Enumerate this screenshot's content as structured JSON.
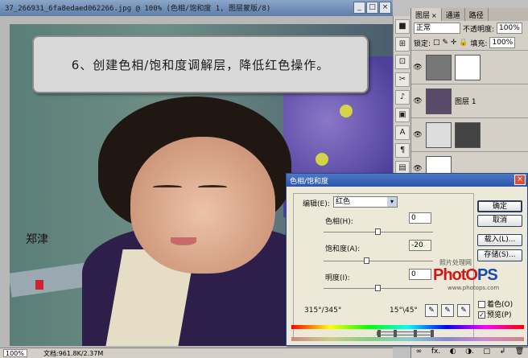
{
  "document": {
    "title": "37_266931_6fa8edaed062266.jpg @ 100% (色相/饱和度 1, 图层蒙版/8)",
    "window_buttons": [
      "_",
      "□",
      "×"
    ],
    "banner_text": "6、创建色相/饱和度调解层，降低红色操作。",
    "status_zoom": "100%",
    "status_doc": "文档:961.8K/2.37M",
    "signature": "郑津"
  },
  "tools": [
    "■",
    "⊞",
    "⊡",
    "✂",
    "♪",
    "▣",
    "A",
    "¶",
    "▤"
  ],
  "layers_panel": {
    "tabs": [
      {
        "label": "图层",
        "close": "×"
      },
      {
        "label": "通道",
        "close": ""
      },
      {
        "label": "路径",
        "close": ""
      }
    ],
    "blend_mode": "正常",
    "opacity_label": "不透明度:",
    "opacity_value": "100%",
    "lock_label": "锁定:",
    "fill_label": "填充:",
    "fill_value": "100%",
    "layers": [
      {
        "name": ""
      },
      {
        "name": "图层 1"
      },
      {
        "name": ""
      },
      {
        "name": ""
      }
    ],
    "bottom_icons": [
      "∞",
      "fx.",
      "◐",
      "◑.",
      "□",
      "↲",
      "🗑"
    ]
  },
  "dialog": {
    "title": "色相/饱和度",
    "close": "×",
    "edit_label": "编辑(E):",
    "edit_value": "红色",
    "hue_label": "色相(H):",
    "hue_value": "0",
    "saturation_label": "饱和度(A):",
    "saturation_value": "-20",
    "lightness_label": "明度(I):",
    "lightness_value": "0",
    "range_left": "315°/345°",
    "range_right": "15°\\45°",
    "buttons": {
      "ok": "确定",
      "cancel": "取消",
      "load": "载入(L)...",
      "save": "存储(S)..."
    },
    "colorize_label": "着色(O)",
    "preview_label": "预览(P)",
    "hue_level": 0.5,
    "saturation_level": 0.4,
    "lightness_level": 0.5
  },
  "watermark": {
    "top": "照片处理网",
    "logo_a": "PhotO",
    "logo_b": "PS",
    "url": "www.photops.com"
  }
}
